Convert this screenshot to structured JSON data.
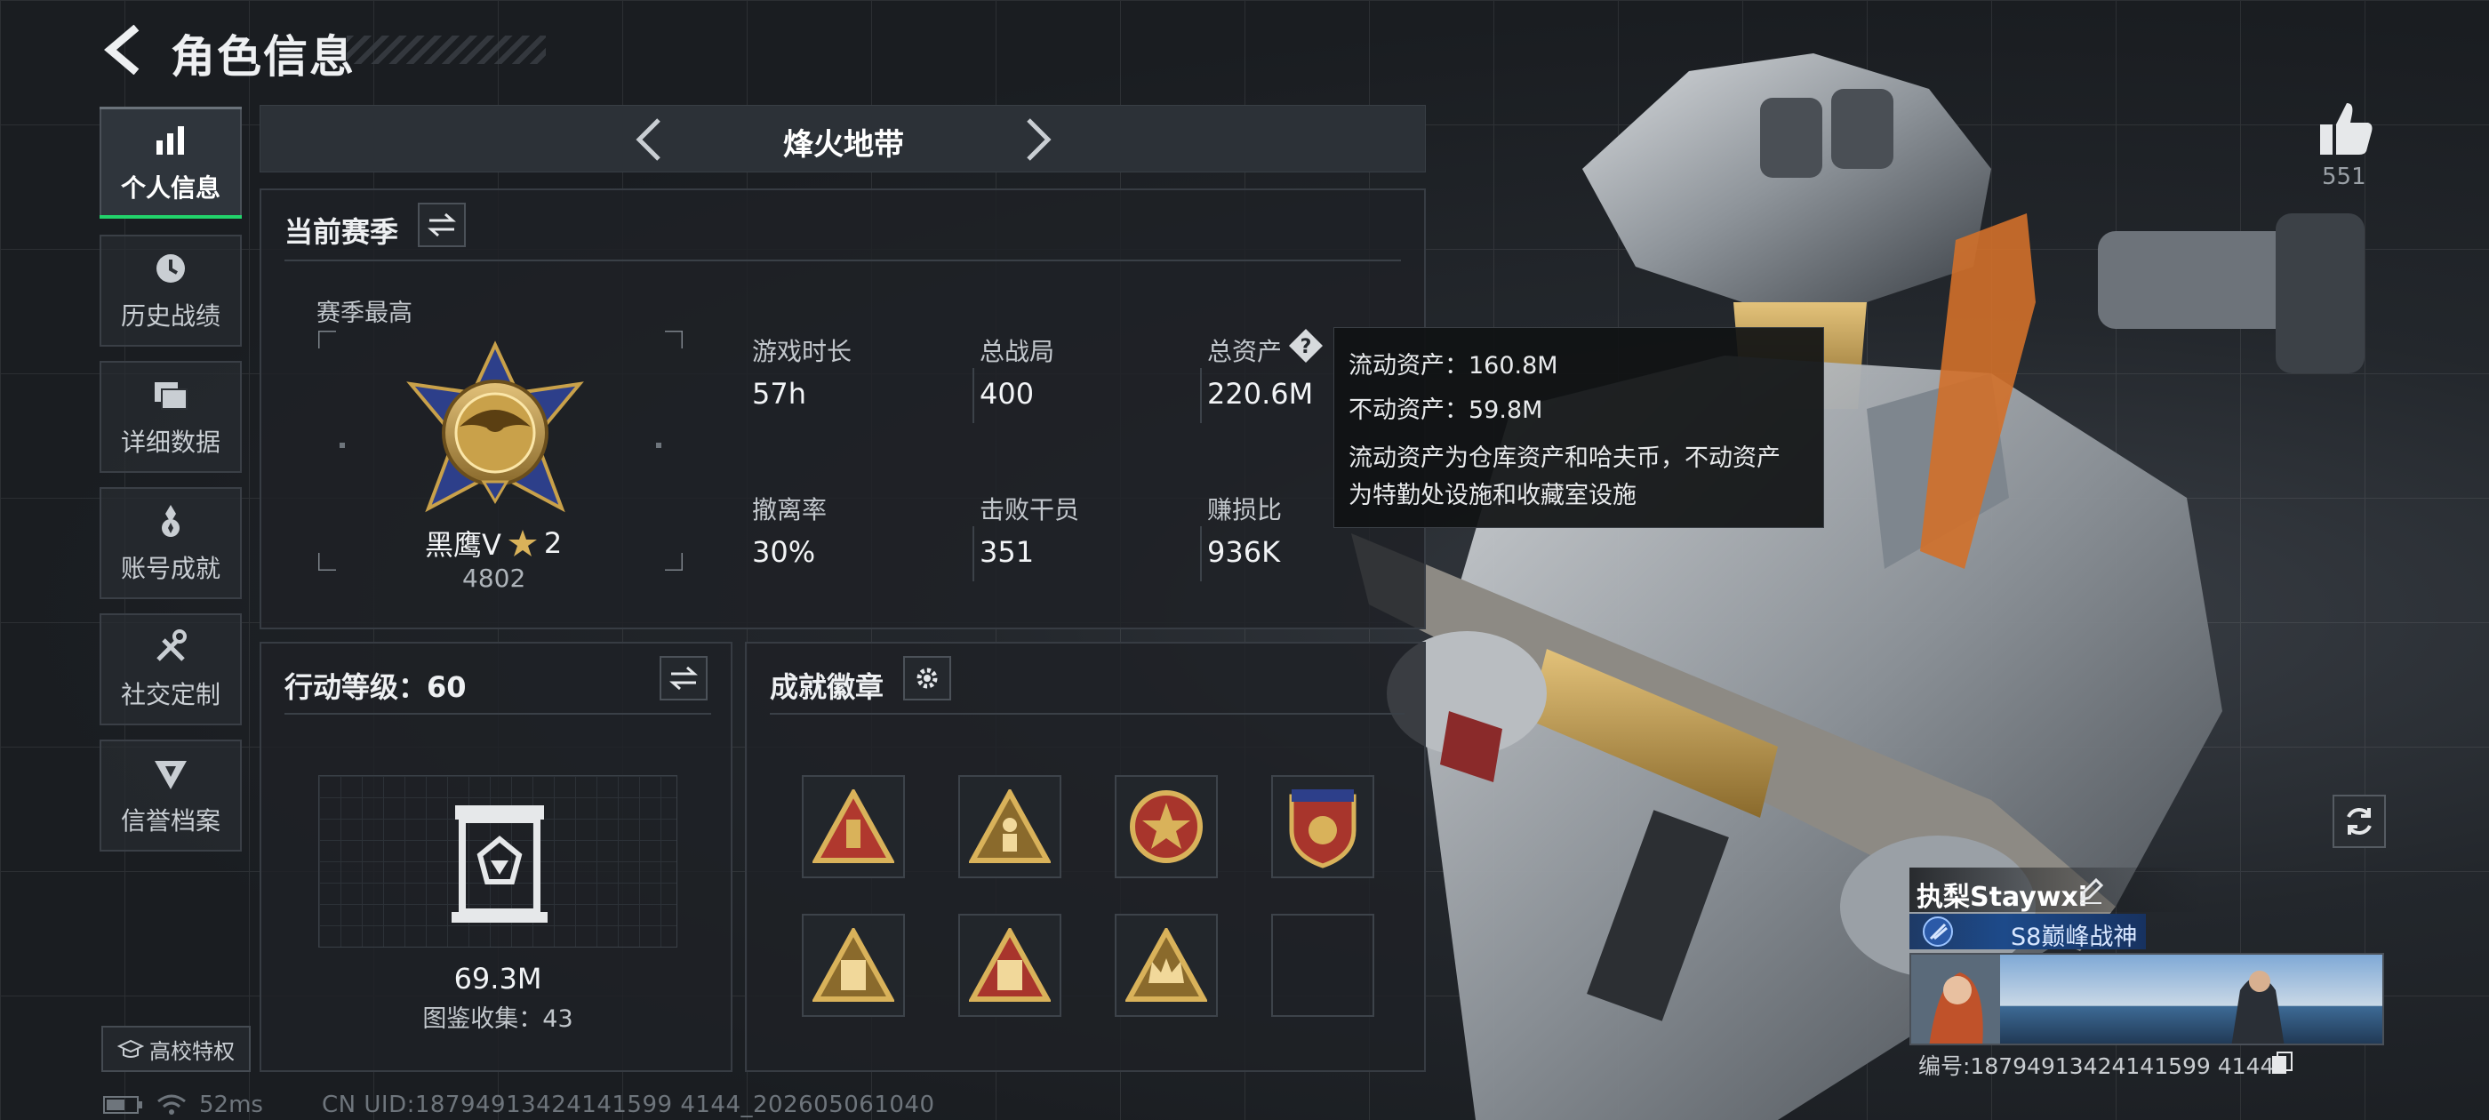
{
  "header": {
    "title": "角色信息"
  },
  "sidebar": {
    "items": [
      {
        "label": "个人信息"
      },
      {
        "label": "历史战绩"
      },
      {
        "label": "详细数据"
      },
      {
        "label": "账号成就"
      },
      {
        "label": "社交定制"
      },
      {
        "label": "信誉档案"
      }
    ],
    "campus_button": "高校特权"
  },
  "status": {
    "ping": "52ms",
    "uid": "CN UID:18794913424141599 4144_202605061040"
  },
  "mode": {
    "name": "烽火地带"
  },
  "season": {
    "title": "当前赛季",
    "best_label": "赛季最高",
    "rank_name": "黑鹰Ⅴ",
    "rank_stars": "2",
    "rank_score": "4802",
    "stats": [
      {
        "label": "游戏时长",
        "value": "57h"
      },
      {
        "label": "总战局",
        "value": "400"
      },
      {
        "label": "总资产",
        "value": "220.6M"
      },
      {
        "label": "撤离率",
        "value": "30%"
      },
      {
        "label": "击败干员",
        "value": "351"
      },
      {
        "label": "赚损比",
        "value": "936K"
      }
    ]
  },
  "tooltip": {
    "liquid": "流动资产：160.8M",
    "fixed": "不动资产：59.8M",
    "desc_line1": "流动资产为仓库资产和哈夫币，不动资产",
    "desc_line2": "为特勤处设施和收藏室设施"
  },
  "action_level": {
    "title": "行动等级：60",
    "value": "69.3M",
    "collection": "图鉴收集：43"
  },
  "achievements": {
    "title": "成就徽章"
  },
  "profile": {
    "likes": "551",
    "name": "执梨Staywxi",
    "title": "S8巅峰战神",
    "id_text": "编号:18794913424141599 4144"
  },
  "colors": {
    "accent_green": "#22d36b",
    "gold": "#c9a14a",
    "title_blue": "#1d4a8a"
  }
}
